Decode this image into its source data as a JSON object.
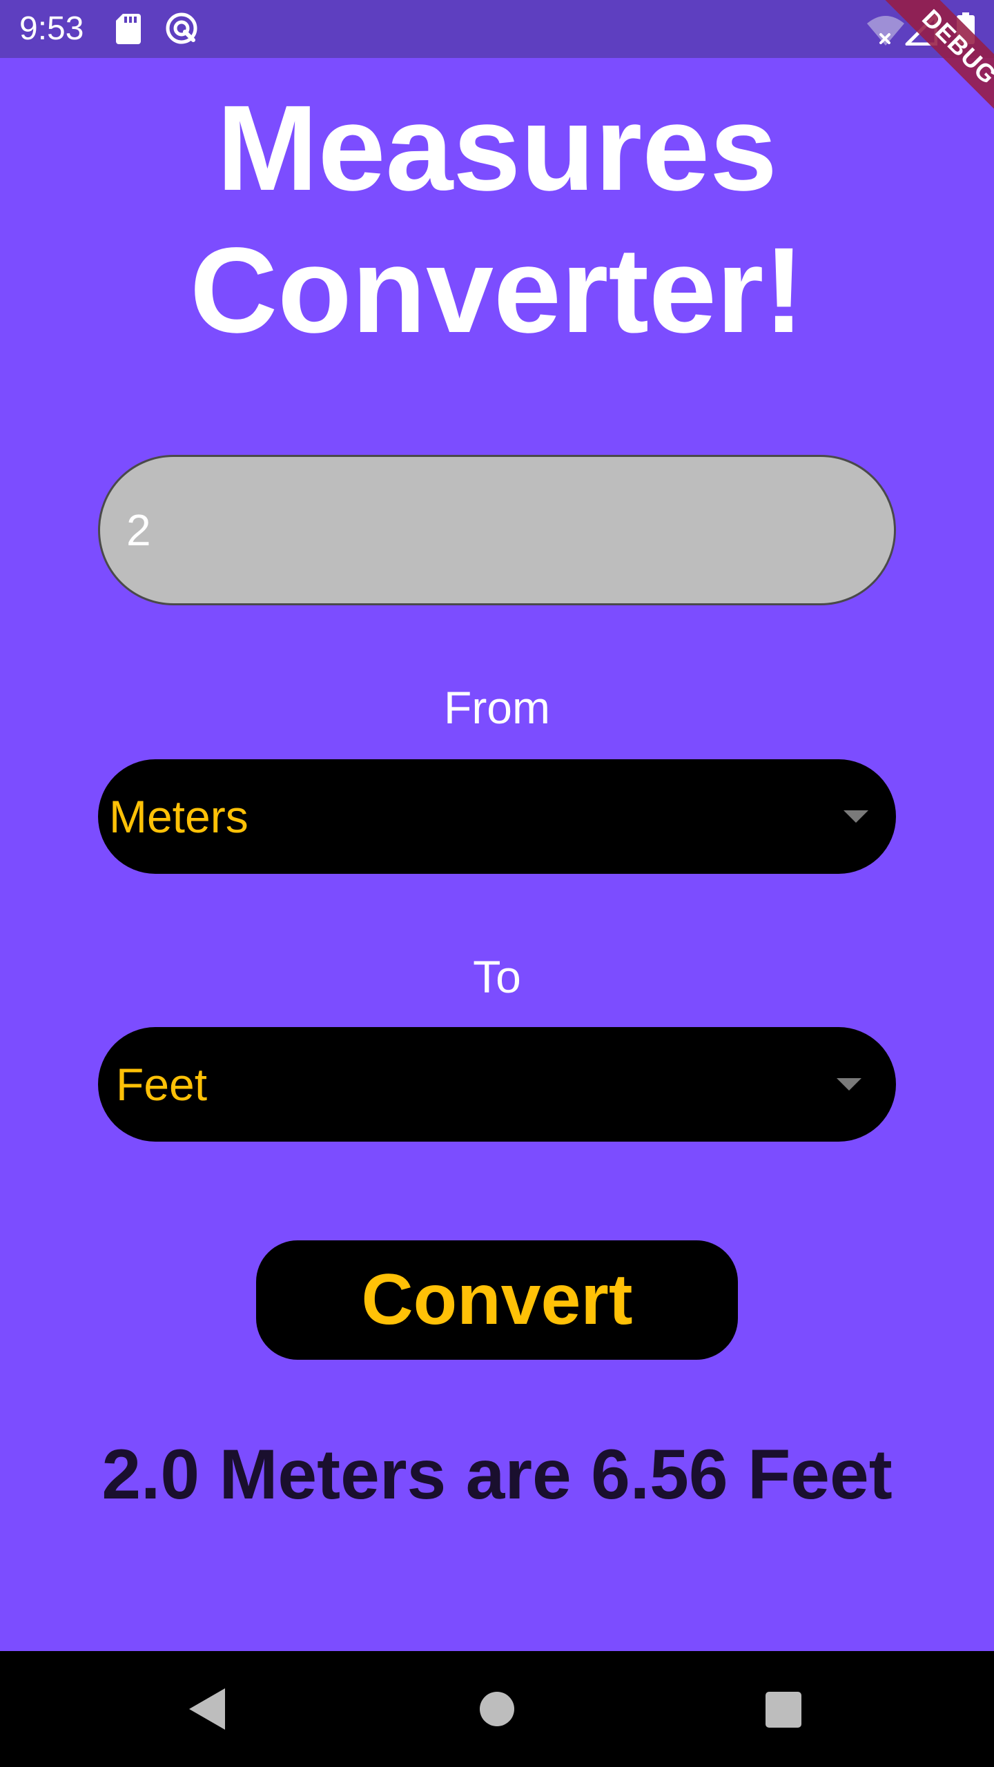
{
  "status_bar": {
    "time": "9:53",
    "icons": [
      "sd-card-icon",
      "sync-icon",
      "wifi-off-icon",
      "signal-icon",
      "battery-icon"
    ]
  },
  "debug_banner": {
    "label": "DEBUG"
  },
  "title": {
    "line1": "Measures",
    "line2": "Converter!"
  },
  "value_input": {
    "value": "2"
  },
  "from": {
    "label": "From",
    "selected": "Meters"
  },
  "to": {
    "label": "To",
    "selected": "Feet"
  },
  "convert_button": {
    "label": "Convert"
  },
  "result": {
    "text": "2.0 Meters are 6.56 Feet"
  },
  "nav_bar": {
    "icons": [
      "back-icon",
      "home-icon",
      "recents-icon"
    ]
  },
  "colors": {
    "background": "#7C4DFF",
    "status_bar": "#5E3FC0",
    "accent_text": "#FFC107",
    "input_fill": "#BDBDBD",
    "control_fill": "#000000",
    "result_text": "#1A0F2E"
  }
}
